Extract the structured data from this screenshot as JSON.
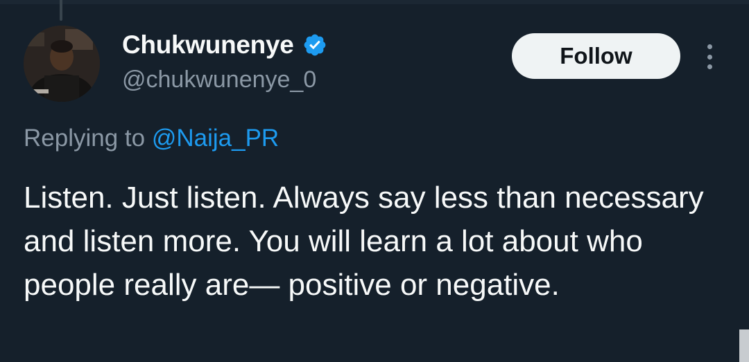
{
  "tweet": {
    "author": {
      "display_name": "Chukwunenye",
      "handle": "@chukwunenye_0",
      "verified": true,
      "verified_icon": "verified-badge-icon",
      "avatar": "profile-photo"
    },
    "follow_button_label": "Follow",
    "more_icon": "more-options-icon",
    "replying_prefix": "Replying to",
    "replying_to": "@Naija_PR",
    "text": "Listen. Just listen. Always say less than necessary and listen more. You will learn a lot about who people really are— positive or negative."
  },
  "colors": {
    "background": "#15202b",
    "primary_text": "#f7f9f9",
    "secondary_text": "#8b98a5",
    "accent": "#1d9bf0",
    "follow_button_bg": "#eff3f4"
  }
}
